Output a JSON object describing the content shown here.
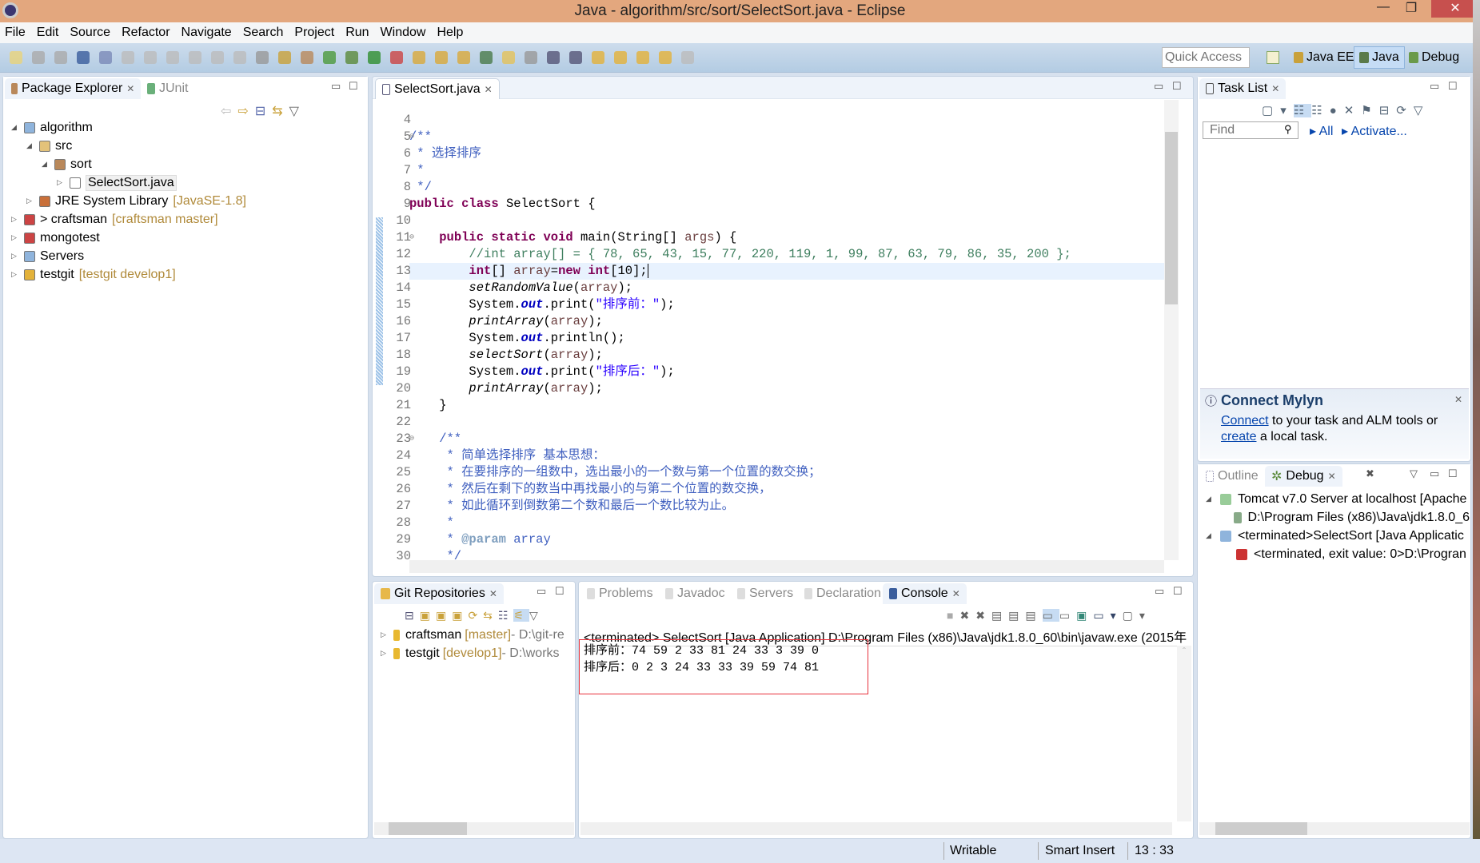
{
  "window": {
    "title": "Java - algorithm/src/sort/SelectSort.java - Eclipse",
    "minimize": "—",
    "restore": "❐",
    "close": "✕"
  },
  "menu": [
    "File",
    "Edit",
    "Source",
    "Refactor",
    "Navigate",
    "Search",
    "Project",
    "Run",
    "Window",
    "Help"
  ],
  "toolbar": {
    "quick_access_placeholder": "Quick Access",
    "perspectives": [
      {
        "label": "Java EE"
      },
      {
        "label": "Java",
        "active": true
      },
      {
        "label": "Debug"
      }
    ]
  },
  "package_explorer": {
    "tabs": [
      {
        "label": "Package Explorer",
        "active": true
      },
      {
        "label": "JUnit"
      }
    ],
    "tree": [
      {
        "label": "algorithm",
        "decoration": "",
        "depth": 0,
        "expanded": true,
        "icon": "project-icon"
      },
      {
        "label": "src",
        "decoration": "",
        "depth": 1,
        "expanded": true,
        "icon": "source-folder-icon"
      },
      {
        "label": "sort",
        "decoration": "",
        "depth": 2,
        "expanded": true,
        "icon": "package-icon"
      },
      {
        "label": "SelectSort.java",
        "decoration": "",
        "depth": 3,
        "expanded": false,
        "icon": "java-file-icon",
        "selected": true
      },
      {
        "label": "JRE System Library",
        "decoration": "[JavaSE-1.8]",
        "depth": 1,
        "expanded": false,
        "icon": "library-icon"
      },
      {
        "label": "> craftsman",
        "decoration": "[craftsman master]",
        "depth": 0,
        "expanded": false,
        "icon": "maven-project-icon"
      },
      {
        "label": "mongotest",
        "decoration": "",
        "depth": 0,
        "expanded": false,
        "icon": "maven-project-icon"
      },
      {
        "label": "Servers",
        "decoration": "",
        "depth": 0,
        "expanded": false,
        "icon": "folder-icon"
      },
      {
        "label": "testgit",
        "decoration": "[testgit develop1]",
        "depth": 0,
        "expanded": false,
        "icon": "git-project-icon"
      }
    ]
  },
  "editor": {
    "tab": "SelectSort.java",
    "cursor_line": 13,
    "lines": [
      {
        "n": "4",
        "t": []
      },
      {
        "n": "5",
        "fold": true,
        "t": [
          [
            "cm",
            "/**"
          ]
        ]
      },
      {
        "n": "6",
        "t": [
          [
            "cm",
            " * 选择排序"
          ]
        ]
      },
      {
        "n": "7",
        "t": [
          [
            "cm",
            " *"
          ]
        ]
      },
      {
        "n": "8",
        "t": [
          [
            "cm",
            " */"
          ]
        ]
      },
      {
        "n": "9",
        "t": [
          [
            "kw",
            "public"
          ],
          [
            "pl",
            " "
          ],
          [
            "kw",
            "class"
          ],
          [
            "pl",
            " SelectSort {"
          ]
        ]
      },
      {
        "n": "10",
        "t": []
      },
      {
        "n": "11",
        "fold": true,
        "t": [
          [
            "pl",
            "    "
          ],
          [
            "kw",
            "public"
          ],
          [
            "pl",
            " "
          ],
          [
            "kw",
            "static"
          ],
          [
            "pl",
            " "
          ],
          [
            "kw",
            "void"
          ],
          [
            "pl",
            " main(String[] "
          ],
          [
            "var",
            "args"
          ],
          [
            "pl",
            ") {"
          ]
        ]
      },
      {
        "n": "12",
        "t": [
          [
            "pl",
            "        "
          ],
          [
            "lc",
            "//int array[] = { 78, 65, 43, 15, 77, 220, 119, 1, 99, 87, 63, 79, 86, 35, 200 };"
          ]
        ]
      },
      {
        "n": "13",
        "t": [
          [
            "pl",
            "        "
          ],
          [
            "kw",
            "int"
          ],
          [
            "pl",
            "[] "
          ],
          [
            "var",
            "array"
          ],
          [
            "pl",
            "="
          ],
          [
            "kw",
            "new"
          ],
          [
            "pl",
            " "
          ],
          [
            "kw",
            "int"
          ],
          [
            "pl",
            "[10];"
          ]
        ]
      },
      {
        "n": "14",
        "t": [
          [
            "pl",
            "        "
          ],
          [
            "it",
            "setRandomValue"
          ],
          [
            "pl",
            "("
          ],
          [
            "var",
            "array"
          ],
          [
            "pl",
            ");"
          ]
        ]
      },
      {
        "n": "15",
        "t": [
          [
            "pl",
            "        System."
          ],
          [
            "fld",
            "out"
          ],
          [
            "pl",
            ".print("
          ],
          [
            "str",
            "\"排序前：\""
          ],
          [
            "pl",
            ");"
          ]
        ]
      },
      {
        "n": "16",
        "t": [
          [
            "pl",
            "        "
          ],
          [
            "it",
            "printArray"
          ],
          [
            "pl",
            "("
          ],
          [
            "var",
            "array"
          ],
          [
            "pl",
            ");"
          ]
        ]
      },
      {
        "n": "17",
        "t": [
          [
            "pl",
            "        System."
          ],
          [
            "fld",
            "out"
          ],
          [
            "pl",
            ".println();"
          ]
        ]
      },
      {
        "n": "18",
        "t": [
          [
            "pl",
            "        "
          ],
          [
            "it",
            "selectSort"
          ],
          [
            "pl",
            "("
          ],
          [
            "var",
            "array"
          ],
          [
            "pl",
            ");"
          ]
        ]
      },
      {
        "n": "19",
        "t": [
          [
            "pl",
            "        System."
          ],
          [
            "fld",
            "out"
          ],
          [
            "pl",
            ".print("
          ],
          [
            "str",
            "\"排序后：\""
          ],
          [
            "pl",
            ");"
          ]
        ]
      },
      {
        "n": "20",
        "t": [
          [
            "pl",
            "        "
          ],
          [
            "it",
            "printArray"
          ],
          [
            "pl",
            "("
          ],
          [
            "var",
            "array"
          ],
          [
            "pl",
            ");"
          ]
        ]
      },
      {
        "n": "21",
        "t": [
          [
            "pl",
            "    }"
          ]
        ]
      },
      {
        "n": "22",
        "t": []
      },
      {
        "n": "23",
        "fold": true,
        "t": [
          [
            "cm",
            "    /**"
          ]
        ]
      },
      {
        "n": "24",
        "t": [
          [
            "cm",
            "     * 简单选择排序 基本思想："
          ]
        ]
      },
      {
        "n": "25",
        "t": [
          [
            "cm",
            "     * 在要排序的一组数中，选出最小的一个数与第一个位置的数交换；"
          ]
        ]
      },
      {
        "n": "26",
        "t": [
          [
            "cm",
            "     * 然后在剩下的数当中再找最小的与第二个位置的数交换，"
          ]
        ]
      },
      {
        "n": "27",
        "t": [
          [
            "cm",
            "     * 如此循环到倒数第二个数和最后一个数比较为止。"
          ]
        ]
      },
      {
        "n": "28",
        "t": [
          [
            "cm",
            "     *"
          ]
        ]
      },
      {
        "n": "29",
        "t": [
          [
            "cm",
            "     * "
          ],
          [
            "tag",
            "@param"
          ],
          [
            "cm",
            " array"
          ]
        ]
      },
      {
        "n": "30",
        "t": [
          [
            "cm",
            "     */"
          ]
        ]
      }
    ]
  },
  "task_list": {
    "tab": "Task List",
    "find_placeholder": "Find",
    "all": "All",
    "activate": "Activate...",
    "mylyn": {
      "title": "Connect Mylyn",
      "connect": "Connect",
      "text1": " to your task and ALM tools or",
      "create": "create",
      "text2": " a local task."
    }
  },
  "debug": {
    "tabs": [
      {
        "label": "Outline"
      },
      {
        "label": "Debug",
        "active": true
      }
    ],
    "tree": [
      {
        "label": "Tomcat v7.0 Server at localhost [Apache",
        "depth": 0,
        "icon": "server-icon"
      },
      {
        "label": "D:\\Program Files (x86)\\Java\\jdk1.8.0_6",
        "depth": 1,
        "icon": "process-icon"
      },
      {
        "label": "<terminated>SelectSort [Java Applicatic",
        "depth": 0,
        "icon": "java-app-icon"
      },
      {
        "label": "<terminated, exit value: 0>D:\\Progran",
        "depth": 1,
        "icon": "terminated-process-icon"
      }
    ]
  },
  "git": {
    "tab": "Git Repositories",
    "repos": [
      {
        "name": "craftsman",
        "branch": "[master]",
        "path": " - D:\\git-re"
      },
      {
        "name": "testgit",
        "branch": "[develop1]",
        "path": " - D:\\works"
      }
    ]
  },
  "console": {
    "tabs": [
      {
        "label": "Problems"
      },
      {
        "label": "Javadoc"
      },
      {
        "label": "Servers"
      },
      {
        "label": "Declaration"
      },
      {
        "label": "Console",
        "active": true
      }
    ],
    "header": "<terminated> SelectSort [Java Application] D:\\Program Files (x86)\\Java\\jdk1.8.0_60\\bin\\javaw.exe (2015年",
    "output": [
      "排序前：74  59  2  33  81  24  33  3  39  0",
      "排序后：0  2  3  24  33  33  39  59  74  81"
    ],
    "highlight_color": "#e8323c"
  },
  "status": {
    "writable": "Writable",
    "insert_mode": "Smart Insert",
    "position": "13 : 33"
  }
}
